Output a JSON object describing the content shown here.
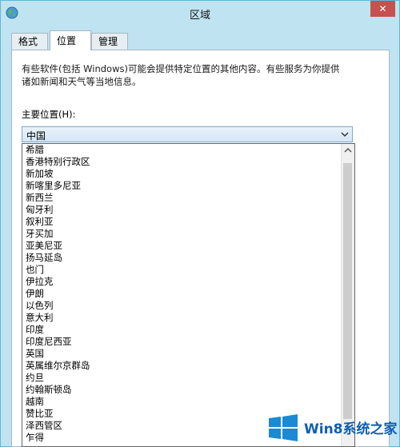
{
  "window": {
    "title": "区域",
    "close_label": "✕"
  },
  "tabs": [
    {
      "label": "格式"
    },
    {
      "label": "位置"
    },
    {
      "label": "管理"
    }
  ],
  "location": {
    "info_text_1": "有些软件(包括 Windows)可能会提供特定位置的其他内容。有些服务为你提供",
    "info_text_2": "诸如新闻和天气等当地信息。",
    "label": "主要位置(H):",
    "selected": "中国",
    "options": [
      "希腊",
      "香港特别行政区",
      "新加坡",
      "新喀里多尼亚",
      "新西兰",
      "匈牙利",
      "叙利亚",
      "牙买加",
      "亚美尼亚",
      "扬马延岛",
      "也门",
      "伊拉克",
      "伊朗",
      "以色列",
      "意大利",
      "印度",
      "印度尼西亚",
      "英国",
      "英属维尔京群岛",
      "约旦",
      "约翰斯顿岛",
      "越南",
      "赞比亚",
      "泽西管区",
      "乍得"
    ]
  },
  "watermark": {
    "text": "Win8系统之家"
  },
  "colors": {
    "title_bar": "#bfe3f0",
    "watermark_blue": "#0d5fb3"
  }
}
